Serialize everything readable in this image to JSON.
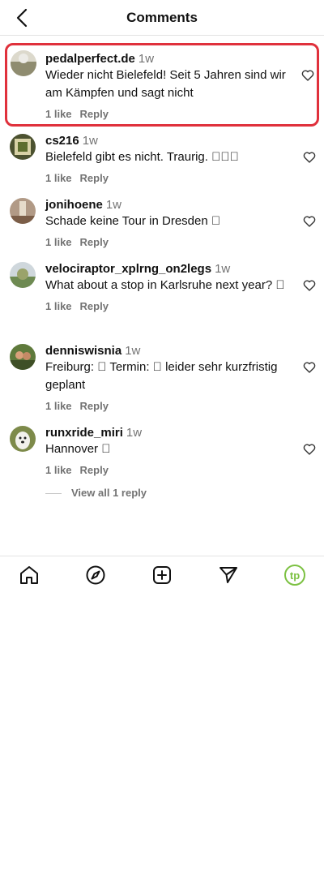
{
  "header": {
    "title": "Comments",
    "back_icon": "back-arrow-icon"
  },
  "comments": [
    {
      "username": "pedalperfect.de",
      "time": "1w",
      "text": "Wieder nicht Bielefeld! Seit 5 Jahren sind wir am Kämpfen und sagt nicht",
      "likes": "1 like",
      "reply": "Reply",
      "highlighted": true
    },
    {
      "username": "cs216",
      "time": "1w",
      "text": "Bielefeld gibt es nicht. Traurig. \u0000\u0000\u0000",
      "likes": "1 like",
      "reply": "Reply"
    },
    {
      "username": "jonihoene",
      "time": "1w",
      "text": "Schade keine Tour in Dresden \u0000",
      "likes": "1 like",
      "reply": "Reply"
    },
    {
      "username": "velociraptor_xplrng_on2legs",
      "time": "1w",
      "text": "What about a stop in Karlsruhe next year? \u0000",
      "likes": "1 like",
      "reply": "Reply"
    },
    {
      "username": "denniswisnia",
      "time": "1w",
      "text": "Freiburg: \u0000 Termin: \u0000 leider sehr kurzfristig geplant",
      "likes": "1 like",
      "reply": "Reply"
    },
    {
      "username": "runxride_miri",
      "time": "1w",
      "text": "Hannover \u0000",
      "likes": "1 like",
      "reply": "Reply"
    }
  ],
  "view_all_replies": "View all 1 reply",
  "nav": [
    "home-icon",
    "explore-icon",
    "create-icon",
    "send-icon",
    "profile-avatar"
  ],
  "profile_initials": "tp",
  "colors": {
    "highlight": "#e0313c",
    "muted": "#737373",
    "profile": "#7cc142"
  }
}
